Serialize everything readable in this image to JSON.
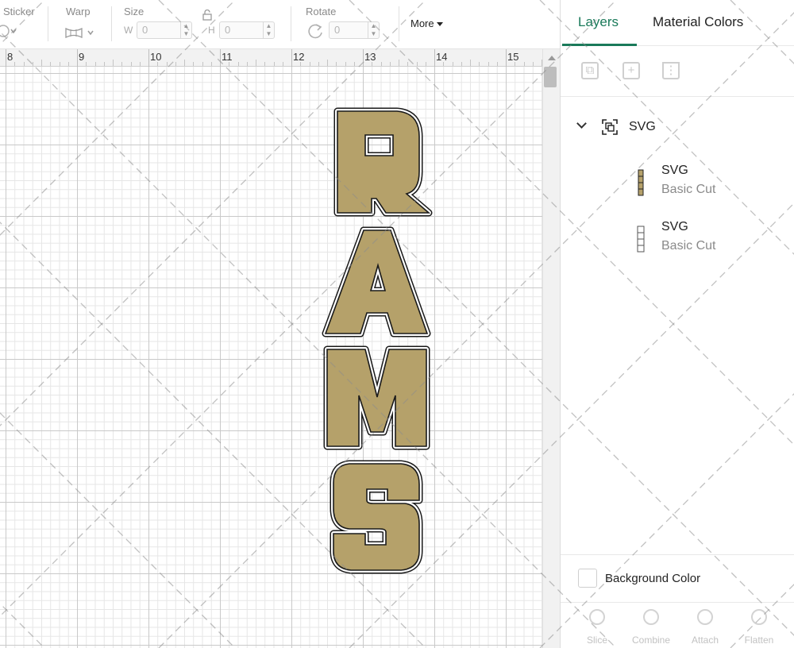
{
  "toolbar": {
    "sticker_label": "Sticker",
    "warp_label": "Warp",
    "size_label": "Size",
    "width_label": "W",
    "width_value": "0",
    "height_label": "H",
    "height_value": "0",
    "rotate_label": "Rotate",
    "rotate_value": "0",
    "more_label": "More"
  },
  "ruler": {
    "ticks": [
      "8",
      "9",
      "10",
      "11",
      "12",
      "13",
      "14",
      "15"
    ]
  },
  "canvas": {
    "text": "RAMS",
    "letters": [
      "R",
      "A",
      "M",
      "S"
    ],
    "fill_color": "#b5a16a",
    "outline_color": "#1a1a1a"
  },
  "panel": {
    "tabs": [
      {
        "label": "Layers",
        "active": true
      },
      {
        "label": "Material Colors",
        "active": false
      }
    ],
    "group": {
      "label": "SVG"
    },
    "layers": [
      {
        "name": "SVG",
        "type": "Basic Cut"
      },
      {
        "name": "SVG",
        "type": "Basic Cut"
      }
    ],
    "background_color_label": "Background Color",
    "bottom_tools": [
      "Slice",
      "Combine",
      "Attach",
      "Flatten"
    ]
  },
  "colors": {
    "accent": "#1a7a5a",
    "letter_fill": "#b5a16a"
  }
}
